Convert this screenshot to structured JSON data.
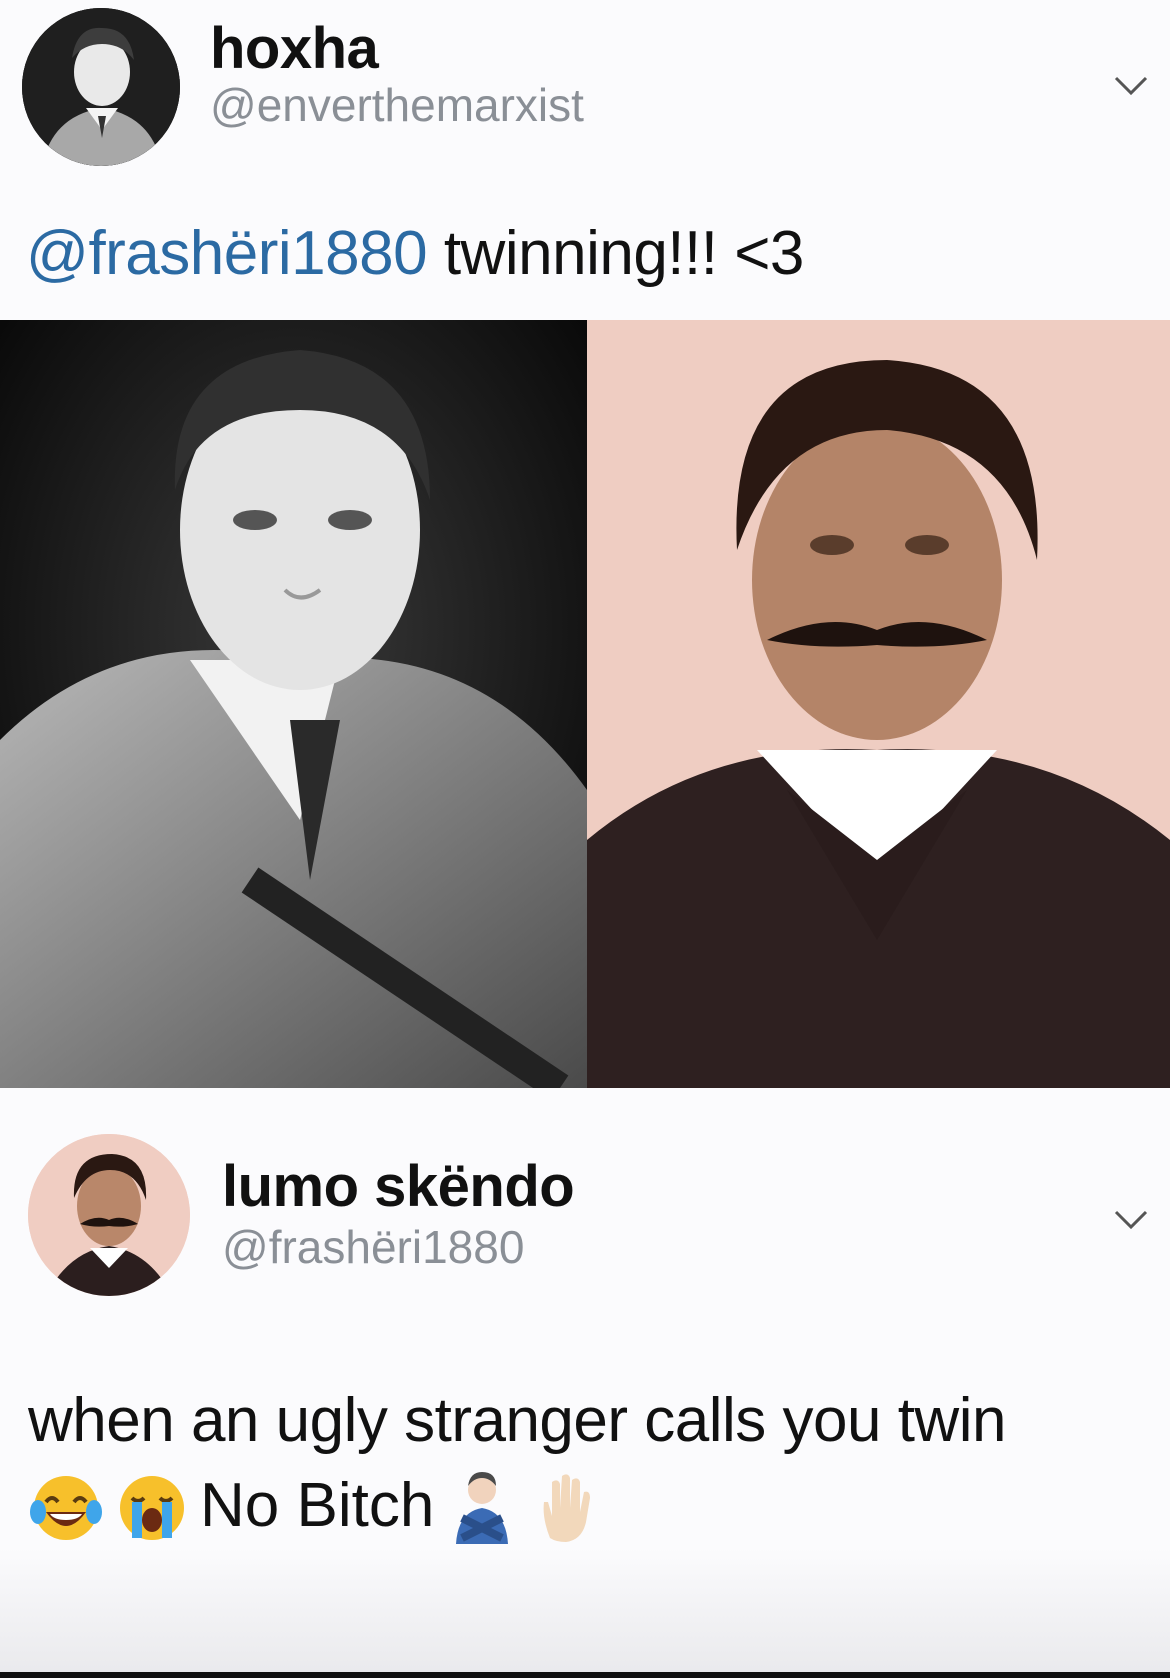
{
  "tweets": [
    {
      "display_name": "hoxha",
      "handle": "@enverthemarxist",
      "text_mention": "@frashëri1880",
      "text_rest": " twinning!!! <3",
      "avatar_icon": "portrait-avatar-icon",
      "menu_icon": "chevron-down-icon"
    },
    {
      "display_name": "lumo skëndo",
      "handle": "@frashëri1880",
      "text_line1": "when an ugly stranger calls you twin",
      "text_line2": "No Bitch",
      "emojis_before": [
        "laughing-tears-emoji",
        "crying-face-emoji"
      ],
      "emojis_after": [
        "person-gesturing-no-emoji",
        "raised-hand-emoji"
      ],
      "avatar_icon": "portrait-avatar-icon",
      "menu_icon": "chevron-down-icon"
    }
  ],
  "images": [
    {
      "name": "left-portrait-photo",
      "description_color": "#1a1a1a"
    },
    {
      "name": "right-portrait-photo",
      "description_color": "#f0cfc4"
    }
  ],
  "colors": {
    "mention": "#2b6aa3",
    "handle": "#8a8f96",
    "background": "#fbfbfd"
  }
}
